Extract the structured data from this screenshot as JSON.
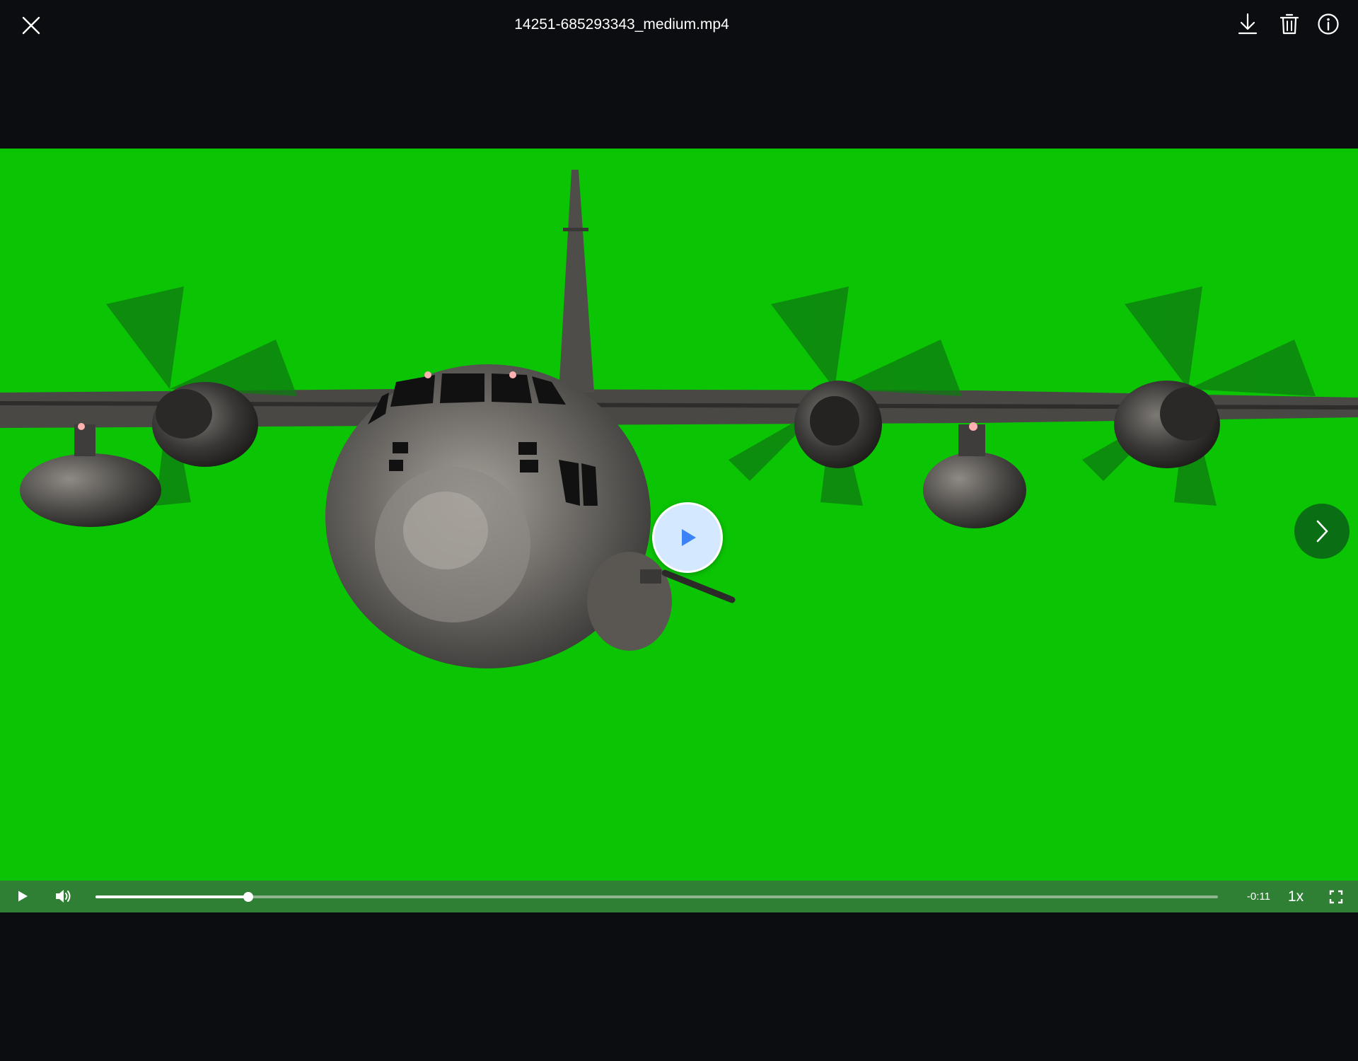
{
  "header": {
    "file_name": "14251-685293343_medium.mp4",
    "close_icon": "close-icon",
    "download_icon": "download-icon",
    "delete_icon": "trash-icon",
    "info_icon": "info-icon"
  },
  "video": {
    "background_color": "#0bc504",
    "content": "airplane",
    "play_overlay_icon": "play-icon",
    "next_icon": "chevron-right-icon"
  },
  "controls": {
    "play_icon": "play-icon",
    "volume_icon": "volume-icon",
    "progress_fraction": 0.136,
    "time_remaining": "-0:11",
    "speed": "1x",
    "fullscreen_icon": "fullscreen-icon",
    "bar_color": "#2f7f34"
  }
}
